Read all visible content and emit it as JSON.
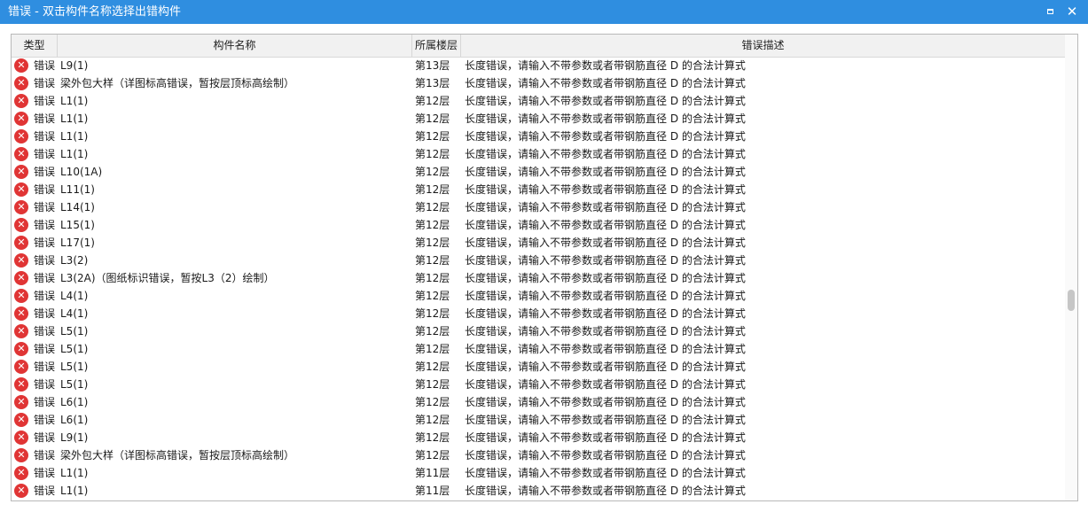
{
  "window": {
    "title": "错误 - 双击构件名称选择出错构件"
  },
  "columns": {
    "type": "类型",
    "name": "构件名称",
    "floor": "所属楼层",
    "desc": "错误描述"
  },
  "icons": {
    "error": "error-icon",
    "maximize": "maximize-icon",
    "close": "close-icon"
  },
  "colors": {
    "titlebar": "#2f8ee0",
    "error": "#e03535"
  },
  "rows": [
    {
      "type": "错误",
      "name": "L9(1)",
      "floor": "第13层",
      "desc": "长度错误，请输入不带参数或者带钢筋直径 D 的合法计算式"
    },
    {
      "type": "错误",
      "name": "梁外包大样（详图标高错误，暂按层顶标高绘制）",
      "floor": "第13层",
      "desc": "长度错误，请输入不带参数或者带钢筋直径 D 的合法计算式"
    },
    {
      "type": "错误",
      "name": "L1(1)",
      "floor": "第12层",
      "desc": "长度错误，请输入不带参数或者带钢筋直径 D 的合法计算式"
    },
    {
      "type": "错误",
      "name": "L1(1)",
      "floor": "第12层",
      "desc": "长度错误，请输入不带参数或者带钢筋直径 D 的合法计算式"
    },
    {
      "type": "错误",
      "name": "L1(1)",
      "floor": "第12层",
      "desc": "长度错误，请输入不带参数或者带钢筋直径 D 的合法计算式"
    },
    {
      "type": "错误",
      "name": "L1(1)",
      "floor": "第12层",
      "desc": "长度错误，请输入不带参数或者带钢筋直径 D 的合法计算式"
    },
    {
      "type": "错误",
      "name": "L10(1A)",
      "floor": "第12层",
      "desc": "长度错误，请输入不带参数或者带钢筋直径 D 的合法计算式"
    },
    {
      "type": "错误",
      "name": "L11(1)",
      "floor": "第12层",
      "desc": "长度错误，请输入不带参数或者带钢筋直径 D 的合法计算式"
    },
    {
      "type": "错误",
      "name": "L14(1)",
      "floor": "第12层",
      "desc": "长度错误，请输入不带参数或者带钢筋直径 D 的合法计算式"
    },
    {
      "type": "错误",
      "name": "L15(1)",
      "floor": "第12层",
      "desc": "长度错误，请输入不带参数或者带钢筋直径 D 的合法计算式"
    },
    {
      "type": "错误",
      "name": "L17(1)",
      "floor": "第12层",
      "desc": "长度错误，请输入不带参数或者带钢筋直径 D 的合法计算式"
    },
    {
      "type": "错误",
      "name": "L3(2)",
      "floor": "第12层",
      "desc": "长度错误，请输入不带参数或者带钢筋直径 D 的合法计算式"
    },
    {
      "type": "错误",
      "name": "L3(2A)（图纸标识错误，暂按L3（2）绘制）",
      "floor": "第12层",
      "desc": "长度错误，请输入不带参数或者带钢筋直径 D 的合法计算式"
    },
    {
      "type": "错误",
      "name": "L4(1)",
      "floor": "第12层",
      "desc": "长度错误，请输入不带参数或者带钢筋直径 D 的合法计算式"
    },
    {
      "type": "错误",
      "name": "L4(1)",
      "floor": "第12层",
      "desc": "长度错误，请输入不带参数或者带钢筋直径 D 的合法计算式"
    },
    {
      "type": "错误",
      "name": "L5(1)",
      "floor": "第12层",
      "desc": "长度错误，请输入不带参数或者带钢筋直径 D 的合法计算式"
    },
    {
      "type": "错误",
      "name": "L5(1)",
      "floor": "第12层",
      "desc": "长度错误，请输入不带参数或者带钢筋直径 D 的合法计算式"
    },
    {
      "type": "错误",
      "name": "L5(1)",
      "floor": "第12层",
      "desc": "长度错误，请输入不带参数或者带钢筋直径 D 的合法计算式"
    },
    {
      "type": "错误",
      "name": "L5(1)",
      "floor": "第12层",
      "desc": "长度错误，请输入不带参数或者带钢筋直径 D 的合法计算式"
    },
    {
      "type": "错误",
      "name": "L6(1)",
      "floor": "第12层",
      "desc": "长度错误，请输入不带参数或者带钢筋直径 D 的合法计算式"
    },
    {
      "type": "错误",
      "name": "L6(1)",
      "floor": "第12层",
      "desc": "长度错误，请输入不带参数或者带钢筋直径 D 的合法计算式"
    },
    {
      "type": "错误",
      "name": "L9(1)",
      "floor": "第12层",
      "desc": "长度错误，请输入不带参数或者带钢筋直径 D 的合法计算式"
    },
    {
      "type": "错误",
      "name": "梁外包大样（详图标高错误，暂按层顶标高绘制）",
      "floor": "第12层",
      "desc": "长度错误，请输入不带参数或者带钢筋直径 D 的合法计算式"
    },
    {
      "type": "错误",
      "name": "L1(1)",
      "floor": "第11层",
      "desc": "长度错误，请输入不带参数或者带钢筋直径 D 的合法计算式"
    },
    {
      "type": "错误",
      "name": "L1(1)",
      "floor": "第11层",
      "desc": "长度错误，请输入不带参数或者带钢筋直径 D 的合法计算式"
    }
  ]
}
